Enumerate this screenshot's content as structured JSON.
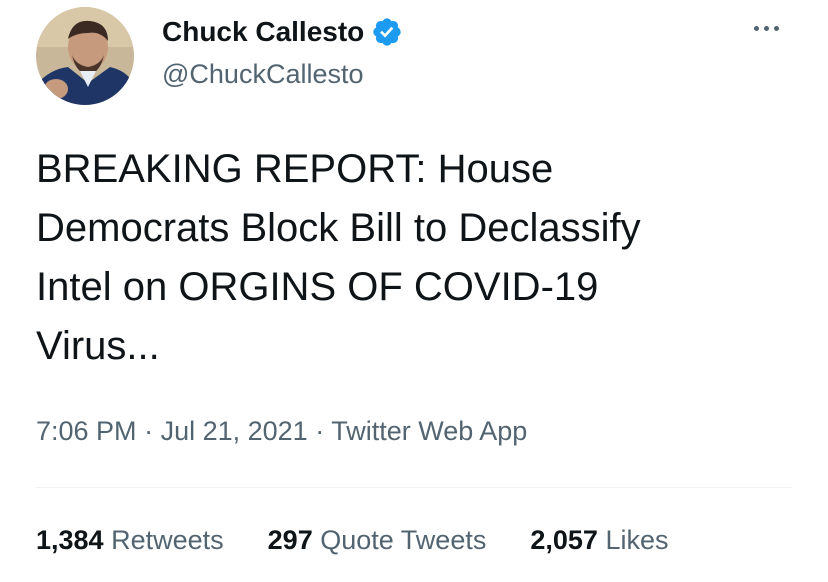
{
  "author": {
    "display_name": "Chuck Callesto",
    "handle": "@ChuckCallesto",
    "verified_icon": "verified-badge-icon",
    "avatar_icon": "avatar-photo"
  },
  "menu": {
    "more_icon": "more-options-icon"
  },
  "tweet": {
    "lines": [
      "BREAKING REPORT: House",
      "Democrats Block Bill to Declassify",
      "Intel on ORGINS OF COVID-19",
      "Virus..."
    ]
  },
  "meta": {
    "time": "7:06 PM",
    "sep1": " · ",
    "date": "Jul 21, 2021",
    "sep2": " · ",
    "source": "Twitter Web App"
  },
  "stats": {
    "retweets_count": "1,384",
    "retweets_label": "Retweets",
    "quotes_count": "297",
    "quotes_label": "Quote Tweets",
    "likes_count": "2,057",
    "likes_label": "Likes"
  },
  "colors": {
    "verified": "#1d9bf0",
    "text": "#0f1419",
    "secondary": "#536471",
    "divider": "#eff3f4"
  }
}
